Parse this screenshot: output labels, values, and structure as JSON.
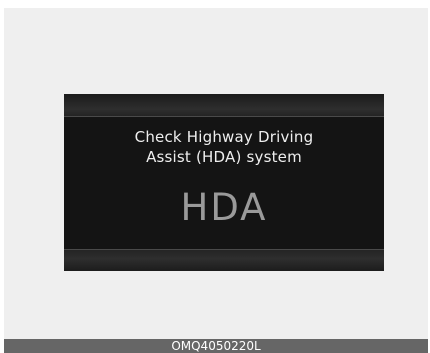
{
  "display": {
    "message_line1": "Check Highway Driving",
    "message_line2": "Assist (HDA) system",
    "indicator": "HDA"
  },
  "figure": {
    "code": "OMQ4050220L"
  }
}
